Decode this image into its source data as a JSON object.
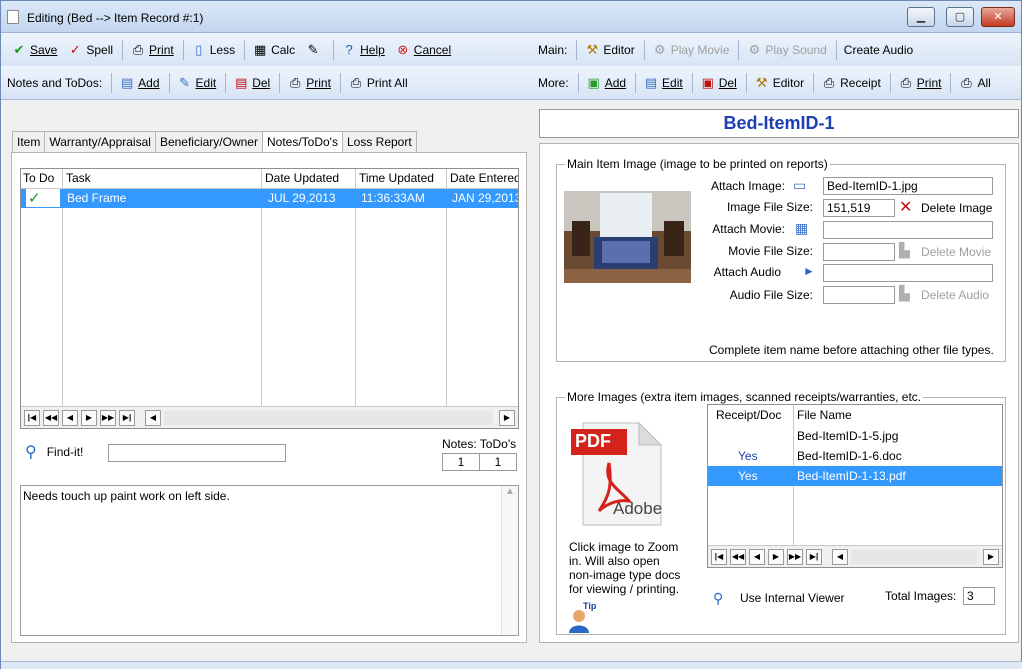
{
  "window": {
    "title": "Editing  (Bed --> Item Record #:1)",
    "buttons": {
      "minimize": "▁",
      "maximize": "▢",
      "close": "✕"
    }
  },
  "main_toolbar": {
    "save": "Save",
    "spell": "Spell",
    "print": "Print",
    "less": "Less",
    "calc": "Calc",
    "help": "Help",
    "cancel": "Cancel"
  },
  "notes_toolbar": {
    "label": "Notes and ToDos:",
    "add": "Add",
    "edit": "Edit",
    "del": "Del",
    "print": "Print",
    "print_all": "Print All"
  },
  "media_toolbar": {
    "label": "Main:",
    "editor": "Editor",
    "play_movie": "Play Movie",
    "play_sound": "Play Sound",
    "create_audio": "Create Audio"
  },
  "more_toolbar": {
    "label": "More:",
    "add": "Add",
    "edit": "Edit",
    "del": "Del",
    "editor": "Editor",
    "receipt": "Receipt",
    "print": "Print",
    "all": "All"
  },
  "tabs": [
    "Item",
    "Warranty/Appraisal",
    "Beneficiary/Owner",
    "Notes/ToDo's",
    "Loss Report"
  ],
  "active_tab": "Notes/ToDo's",
  "todo_grid": {
    "columns": [
      "To Do",
      "Task",
      "Date Updated",
      "Time Updated",
      "Date Entered"
    ],
    "rows": [
      {
        "todo": "✓",
        "task": "Bed Frame",
        "date_updated": "JUL 29,2013",
        "time_updated": "11:36:33AM",
        "date_entered": "JAN 29,2013"
      }
    ]
  },
  "nav": {
    "first": "|◀",
    "prev_page": "◀◀",
    "prev": "◀",
    "next": "▶",
    "next_page": "▶▶",
    "last": "▶|",
    "scroll_left": "◀",
    "scroll_right": "▶"
  },
  "find": {
    "label": "Find-it!",
    "value": ""
  },
  "notes_counts": {
    "label": "Notes: ToDo's",
    "notes": "1",
    "todos": "1"
  },
  "notes_text": "Needs touch up paint work on left side.",
  "item_banner": "Bed-ItemID-1",
  "main_image": {
    "legend": "Main Item Image (image to be printed on reports)",
    "attach_image_label": "Attach Image:",
    "attach_image_value": "Bed-ItemID-1.jpg",
    "image_size_label": "Image File Size:",
    "image_size_value": "151,519",
    "delete_image": "Delete Image",
    "attach_movie_label": "Attach Movie:",
    "movie_size_label": "Movie File Size:",
    "delete_movie": "Delete Movie",
    "attach_audio_label": "Attach Audio",
    "audio_size_label": "Audio File Size:",
    "delete_audio": "Delete Audio",
    "note": "Complete item name before attaching other file types."
  },
  "more_images": {
    "legend": "More Images (extra item images, scanned receipts/warranties, etc.",
    "columns": [
      "Receipt/Doc",
      "File Name"
    ],
    "rows": [
      {
        "receipt": "",
        "file": "Bed-ItemID-1-5.jpg"
      },
      {
        "receipt": "Yes",
        "file": "Bed-ItemID-1-6.doc"
      },
      {
        "receipt": "Yes",
        "file": "Bed-ItemID-1-13.pdf"
      }
    ],
    "selected_row": 2,
    "pdf_label": "PDF",
    "adobe_label": "Adobe",
    "zoom_hint": "Click image to Zoom in. Will also open non-image type docs for viewing / printing.",
    "tip_label": "Tip",
    "use_viewer": "Use Internal Viewer",
    "total_label": "Total Images:",
    "total_value": "3"
  },
  "colors": {
    "selection": "#3399ff",
    "banner_text": "#1f3fb5",
    "toolbar_bg": "#d7e4f5"
  }
}
